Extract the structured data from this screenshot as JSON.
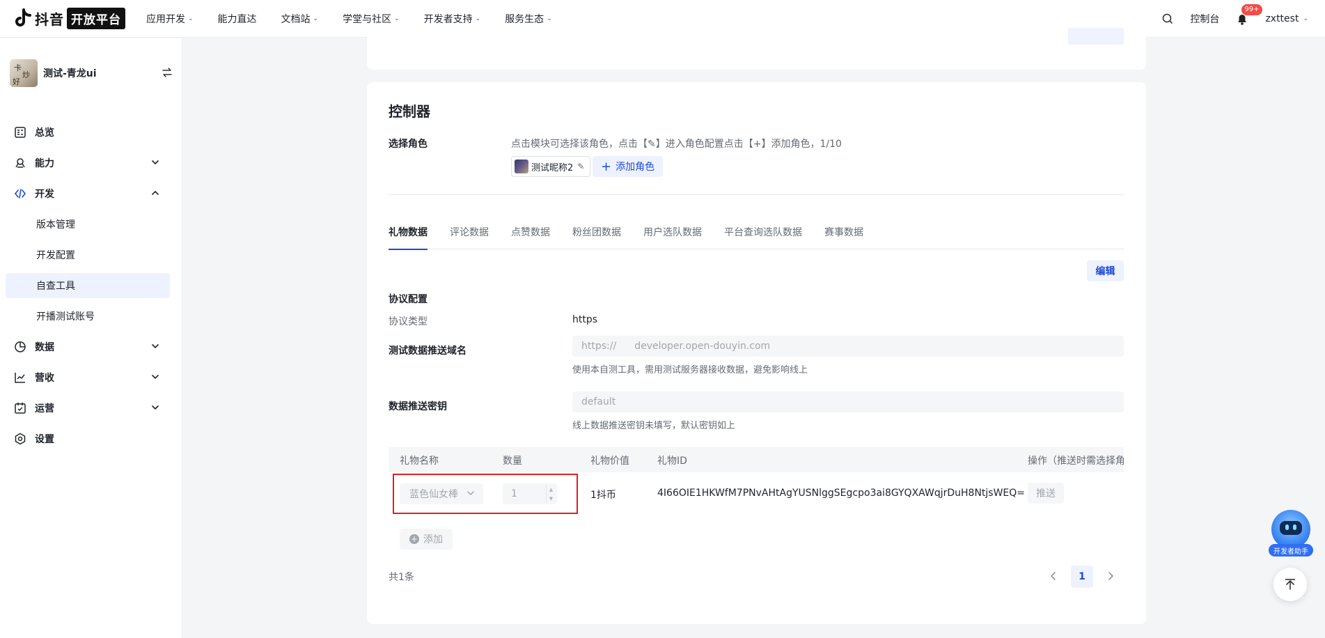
{
  "brand": {
    "name": "抖音",
    "badge": "开放平台"
  },
  "nav": {
    "items": [
      {
        "label": "应用开发",
        "has_dropdown": true
      },
      {
        "label": "能力直达",
        "has_dropdown": false
      },
      {
        "label": "文档站",
        "has_dropdown": true
      },
      {
        "label": "学堂与社区",
        "has_dropdown": true
      },
      {
        "label": "开发者支持",
        "has_dropdown": true
      },
      {
        "label": "服务生态",
        "has_dropdown": true
      }
    ],
    "console": "控制台",
    "notifications": "99+",
    "user": "zxttest"
  },
  "sidebar": {
    "app_name": "测试-青龙ui",
    "items": [
      {
        "label": "总览",
        "icon": "dashboard-icon"
      },
      {
        "label": "能力",
        "icon": "capability-icon",
        "expand": "down"
      },
      {
        "label": "开发",
        "icon": "code-icon",
        "expand": "up"
      },
      {
        "label": "数据",
        "icon": "pie-chart-icon",
        "expand": "down"
      },
      {
        "label": "营收",
        "icon": "revenue-chart-icon",
        "expand": "down"
      },
      {
        "label": "运营",
        "icon": "calendar-check-icon",
        "expand": "down"
      },
      {
        "label": "设置",
        "icon": "settings-icon"
      }
    ],
    "dev_sub": [
      {
        "label": "版本管理"
      },
      {
        "label": "开发配置"
      },
      {
        "label": "自查工具",
        "active": true
      },
      {
        "label": "开播测试账号"
      }
    ]
  },
  "controller": {
    "title": "控制器",
    "role_label": "选择角色",
    "role_hint": "点击模块可选择该角色，点击【✎】进入角色配置点击【+】添加角色，1/10",
    "role_chip": "测试昵称2",
    "add_role": "添加角色",
    "tabs": [
      "礼物数据",
      "评论数据",
      "点赞数据",
      "粉丝团数据",
      "用户选队数据",
      "平台查询选队数据",
      "赛事数据"
    ],
    "active_tab": 0,
    "edit": "编辑",
    "protocol": {
      "section_title": "协议配置",
      "type_label": "协议类型",
      "type_value": "https",
      "domain_label": "测试数据推送域名",
      "domain_prefix": "https://",
      "domain_placeholder": "developer.open-douyin.com",
      "domain_help": "使用本自测工具，需用测试服务器接收数据，避免影响线上",
      "secret_label": "数据推送密钥",
      "secret_placeholder": "default",
      "secret_help": "线上数据推送密钥未填写，默认密钥如上"
    },
    "table": {
      "headers": [
        "礼物名称",
        "数量",
        "礼物价值",
        "礼物ID",
        "操作（推送时需选择角"
      ],
      "rows": [
        {
          "gift_name": "蓝色仙女棒",
          "quantity": "1",
          "value": "1抖币",
          "gift_id": "4I66OIE1HKWfM7PNvAHtAgYUSNlggSEgcpo3ai8GYQXAWqjrDuH8NtjsWEQ=",
          "action": "推送"
        }
      ],
      "add": "添加"
    },
    "total": "共1条",
    "page": "1"
  },
  "assistant_label": "开发者助手",
  "colors": {
    "accent": "#1d4ad9",
    "highlight": "#e02020",
    "badge": "#f54a45"
  }
}
